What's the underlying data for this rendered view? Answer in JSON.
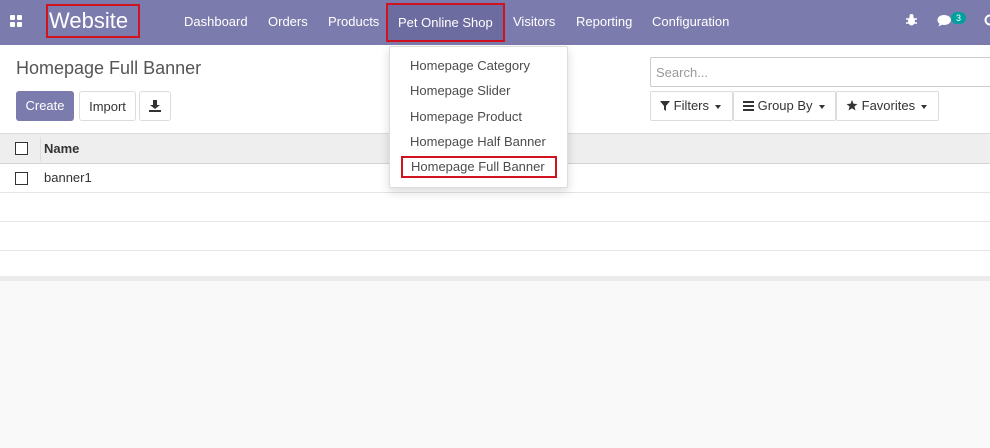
{
  "topbar": {
    "brand": "Website",
    "menu": [
      "Dashboard",
      "Orders",
      "Products",
      "Pet Online Shop",
      "Visitors",
      "Reporting",
      "Configuration"
    ],
    "active_menu": "Pet Online Shop",
    "message_count": "3"
  },
  "dropdown": {
    "items": [
      "Homepage Category",
      "Homepage Slider",
      "Homepage Product",
      "Homepage Half Banner",
      "Homepage Full Banner"
    ],
    "highlighted": "Homepage Full Banner"
  },
  "control_panel": {
    "title": "Homepage Full Banner",
    "create_label": "Create",
    "import_label": "Import",
    "search_placeholder": "Search...",
    "filters_label": "Filters",
    "group_by_label": "Group By",
    "favorites_label": "Favorites"
  },
  "table": {
    "header": "Name",
    "rows": [
      "banner1"
    ]
  },
  "colors": {
    "navbar": "#7c7bad",
    "highlight": "#d0131e",
    "badge": "#00a09d"
  }
}
